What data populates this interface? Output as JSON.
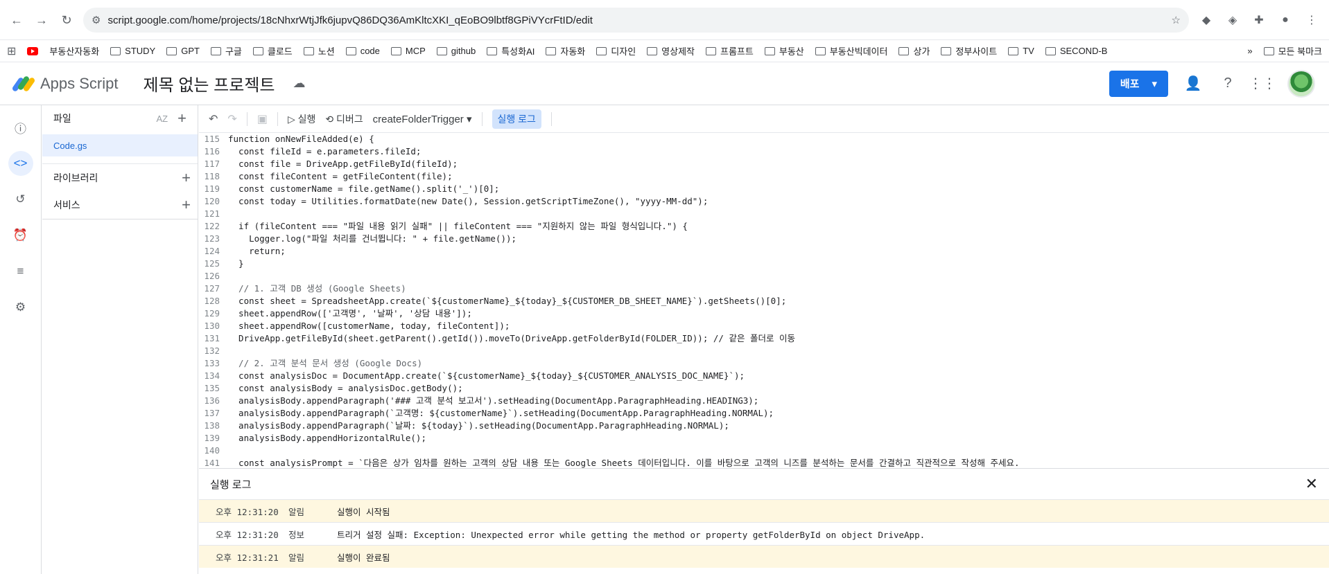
{
  "browser": {
    "url": "script.google.com/home/projects/18cNhxrWtjJfk6jupvQ86DQ36AmKltcXKI_qEoBO9lbtf8GPiVYcrFtID/edit",
    "bookmarks": [
      "부동산자동화",
      "STUDY",
      "GPT",
      "구글",
      "클로드",
      "노션",
      "code",
      "MCP",
      "github",
      "특성화AI",
      "자동화",
      "디자인",
      "영상제작",
      "프롬프트",
      "부동산",
      "부동산빅데이터",
      "상가",
      "정부사이트",
      "TV",
      "SECOND-B"
    ],
    "all_bookmarks": "모든 북마크"
  },
  "app": {
    "name": "Apps Script",
    "project_title": "제목 없는 프로젝트",
    "deploy": "배포"
  },
  "files_panel": {
    "title": "파일",
    "file": "Code.gs",
    "libraries": "라이브러리",
    "services": "서비스"
  },
  "toolbar": {
    "run": "실행",
    "debug": "디버그",
    "function": "createFolderTrigger",
    "exec_log": "실행 로그"
  },
  "code_lines": [
    {
      "n": "115",
      "t": "function onNewFileAdded(e) {"
    },
    {
      "n": "116",
      "t": "  const fileId = e.parameters.fileId;"
    },
    {
      "n": "117",
      "t": "  const file = DriveApp.getFileById(fileId);"
    },
    {
      "n": "118",
      "t": "  const fileContent = getFileContent(file);"
    },
    {
      "n": "119",
      "t": "  const customerName = file.getName().split('_')[0];"
    },
    {
      "n": "120",
      "t": "  const today = Utilities.formatDate(new Date(), Session.getScriptTimeZone(), \"yyyy-MM-dd\");"
    },
    {
      "n": "121",
      "t": ""
    },
    {
      "n": "122",
      "t": "  if (fileContent === \"파일 내용 읽기 실패\" || fileContent === \"지원하지 않는 파일 형식입니다.\") {"
    },
    {
      "n": "123",
      "t": "    Logger.log(\"파일 처리를 건너뜁니다: \" + file.getName());"
    },
    {
      "n": "124",
      "t": "    return;"
    },
    {
      "n": "125",
      "t": "  }"
    },
    {
      "n": "126",
      "t": ""
    },
    {
      "n": "127",
      "t": "  // 1. 고객 DB 생성 (Google Sheets)"
    },
    {
      "n": "128",
      "t": "  const sheet = SpreadsheetApp.create(`${customerName}_${today}_${CUSTOMER_DB_SHEET_NAME}`).getSheets()[0];"
    },
    {
      "n": "129",
      "t": "  sheet.appendRow(['고객명', '날짜', '상담 내용']);"
    },
    {
      "n": "130",
      "t": "  sheet.appendRow([customerName, today, fileContent]);"
    },
    {
      "n": "131",
      "t": "  DriveApp.getFileById(sheet.getParent().getId()).moveTo(DriveApp.getFolderById(FOLDER_ID)); // 같은 폴더로 이동"
    },
    {
      "n": "132",
      "t": ""
    },
    {
      "n": "133",
      "t": "  // 2. 고객 분석 문서 생성 (Google Docs)"
    },
    {
      "n": "134",
      "t": "  const analysisDoc = DocumentApp.create(`${customerName}_${today}_${CUSTOMER_ANALYSIS_DOC_NAME}`);"
    },
    {
      "n": "135",
      "t": "  const analysisBody = analysisDoc.getBody();"
    },
    {
      "n": "136",
      "t": "  analysisBody.appendParagraph('### 고객 분석 보고서').setHeading(DocumentApp.ParagraphHeading.HEADING3);"
    },
    {
      "n": "137",
      "t": "  analysisBody.appendParagraph(`고객명: ${customerName}`).setHeading(DocumentApp.ParagraphHeading.NORMAL);"
    },
    {
      "n": "138",
      "t": "  analysisBody.appendParagraph(`날짜: ${today}`).setHeading(DocumentApp.ParagraphHeading.NORMAL);"
    },
    {
      "n": "139",
      "t": "  analysisBody.appendHorizontalRule();"
    },
    {
      "n": "140",
      "t": ""
    },
    {
      "n": "141",
      "t": "  const analysisPrompt = `다음은 상가 임차를 원하는 고객의 상담 내용 또는 Google Sheets 데이터입니다. 이를 바탕으로 고객의 니즈를 분석하는 문서를 간결하고 직관적으로 작성해 주세요."
    }
  ],
  "log": {
    "title": "실행 로그",
    "rows": [
      {
        "time": "오후 12:31:20",
        "level": "알림",
        "msg": "실행이 시작됨",
        "warn": true
      },
      {
        "time": "오후 12:31:20",
        "level": "정보",
        "msg": "트리거 설정 실패: Exception: Unexpected error while getting the method or property getFolderById on object DriveApp.",
        "warn": false
      },
      {
        "time": "오후 12:31:21",
        "level": "알림",
        "msg": "실행이 완료됨",
        "warn": true
      }
    ]
  }
}
